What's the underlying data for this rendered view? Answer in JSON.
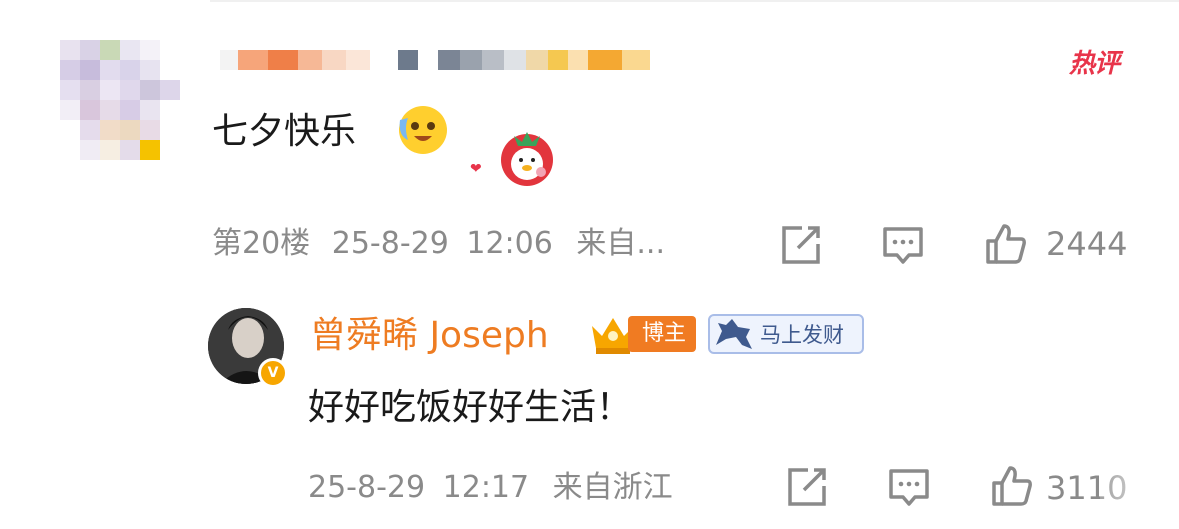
{
  "hot_badge": {
    "label": "热评"
  },
  "main_comment": {
    "text": "七夕快乐",
    "floor": "第20楼",
    "date": "25-8-29",
    "time": "12:06",
    "source": "来自...",
    "like_count": "2444"
  },
  "reply": {
    "author": "曾舜晞 Joseph",
    "blogger_badge": "博主",
    "fortune_badge": "马上发财",
    "text": "好好吃饭好好生活！",
    "date": "25-8-29",
    "time": "12:17",
    "source": "来自浙江",
    "like_count": "3110"
  },
  "icons": [
    "share-icon",
    "comment-icon",
    "like-icon",
    "crown-icon",
    "horse-icon",
    "verified-icon",
    "emoji-face-icon",
    "strawberry-sticker-icon",
    "heart-icon"
  ],
  "colors": {
    "accent_orange": "#ee7c22",
    "hot_red": "#e8344a",
    "meta_gray": "#8a8a8a",
    "badge_blue": "#3f5a8e"
  }
}
